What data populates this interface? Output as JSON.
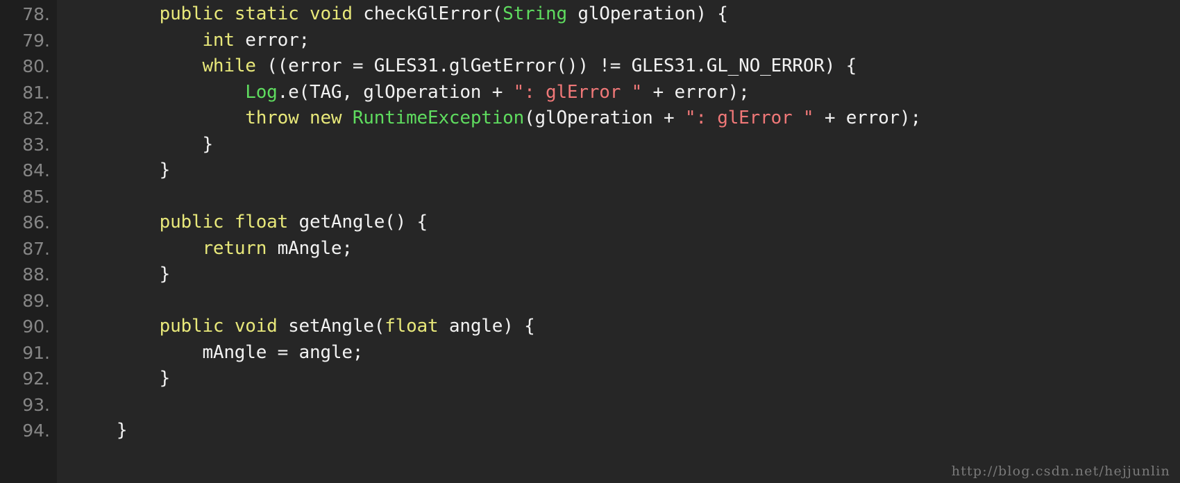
{
  "editor": {
    "theme": {
      "gutter_background": "#1e1e1e",
      "code_background": "#262626",
      "line_number_color": "#868686",
      "plain_text_color": "#f2f2f2",
      "keyword_color": "#e8e87a",
      "type_color": "#5fdc5f",
      "string_color": "#f07878"
    },
    "language": "Java",
    "first_line_number": 78,
    "last_line_number": 94,
    "lines": [
      {
        "number": "78.",
        "text": "        public static void checkGlError(String glOperation) {",
        "tokens": [
          {
            "text": "        ",
            "kind": "plain"
          },
          {
            "text": "public static void",
            "kind": "keyword"
          },
          {
            "text": " checkGlError(",
            "kind": "plain"
          },
          {
            "text": "String",
            "kind": "type"
          },
          {
            "text": " glOperation) {",
            "kind": "plain"
          }
        ]
      },
      {
        "number": "79.",
        "text": "            int error;",
        "tokens": [
          {
            "text": "            ",
            "kind": "plain"
          },
          {
            "text": "int",
            "kind": "keyword"
          },
          {
            "text": " error;",
            "kind": "plain"
          }
        ]
      },
      {
        "number": "80.",
        "text": "            while ((error = GLES31.glGetError()) != GLES31.GL_NO_ERROR) {",
        "tokens": [
          {
            "text": "            ",
            "kind": "plain"
          },
          {
            "text": "while",
            "kind": "keyword"
          },
          {
            "text": " ((error = GLES31.glGetError()) != GLES31.GL_NO_ERROR) {",
            "kind": "plain"
          }
        ]
      },
      {
        "number": "81.",
        "text": "                Log.e(TAG, glOperation + \": glError \" + error);",
        "tokens": [
          {
            "text": "                ",
            "kind": "plain"
          },
          {
            "text": "Log",
            "kind": "type"
          },
          {
            "text": ".e(TAG, glOperation + ",
            "kind": "plain"
          },
          {
            "text": "\": glError \"",
            "kind": "string"
          },
          {
            "text": " + error);",
            "kind": "plain"
          }
        ]
      },
      {
        "number": "82.",
        "text": "                throw new RuntimeException(glOperation + \": glError \" + error);",
        "tokens": [
          {
            "text": "                ",
            "kind": "plain"
          },
          {
            "text": "throw new",
            "kind": "keyword"
          },
          {
            "text": " ",
            "kind": "plain"
          },
          {
            "text": "RuntimeException",
            "kind": "type"
          },
          {
            "text": "(glOperation + ",
            "kind": "plain"
          },
          {
            "text": "\": glError \"",
            "kind": "string"
          },
          {
            "text": " + error);",
            "kind": "plain"
          }
        ]
      },
      {
        "number": "83.",
        "text": "            }",
        "tokens": [
          {
            "text": "            }",
            "kind": "plain"
          }
        ]
      },
      {
        "number": "84.",
        "text": "        }",
        "tokens": [
          {
            "text": "        }",
            "kind": "plain"
          }
        ]
      },
      {
        "number": "85.",
        "text": "",
        "tokens": []
      },
      {
        "number": "86.",
        "text": "        public float getAngle() {",
        "tokens": [
          {
            "text": "        ",
            "kind": "plain"
          },
          {
            "text": "public float",
            "kind": "keyword"
          },
          {
            "text": " getAngle() {",
            "kind": "plain"
          }
        ]
      },
      {
        "number": "87.",
        "text": "            return mAngle;",
        "tokens": [
          {
            "text": "            ",
            "kind": "plain"
          },
          {
            "text": "return",
            "kind": "keyword"
          },
          {
            "text": " mAngle;",
            "kind": "plain"
          }
        ]
      },
      {
        "number": "88.",
        "text": "        }",
        "tokens": [
          {
            "text": "        }",
            "kind": "plain"
          }
        ]
      },
      {
        "number": "89.",
        "text": "",
        "tokens": []
      },
      {
        "number": "90.",
        "text": "        public void setAngle(float angle) {",
        "tokens": [
          {
            "text": "        ",
            "kind": "plain"
          },
          {
            "text": "public void",
            "kind": "keyword"
          },
          {
            "text": " setAngle(",
            "kind": "plain"
          },
          {
            "text": "float",
            "kind": "keyword"
          },
          {
            "text": " angle) {",
            "kind": "plain"
          }
        ]
      },
      {
        "number": "91.",
        "text": "            mAngle = angle;",
        "tokens": [
          {
            "text": "            mAngle = angle;",
            "kind": "plain"
          }
        ]
      },
      {
        "number": "92.",
        "text": "        }",
        "tokens": [
          {
            "text": "        }",
            "kind": "plain"
          }
        ]
      },
      {
        "number": "93.",
        "text": "",
        "tokens": []
      },
      {
        "number": "94.",
        "text": "    }",
        "tokens": [
          {
            "text": "    }",
            "kind": "plain"
          }
        ]
      }
    ]
  },
  "watermark": {
    "text": "http://blog.csdn.net/hejjunlin"
  }
}
